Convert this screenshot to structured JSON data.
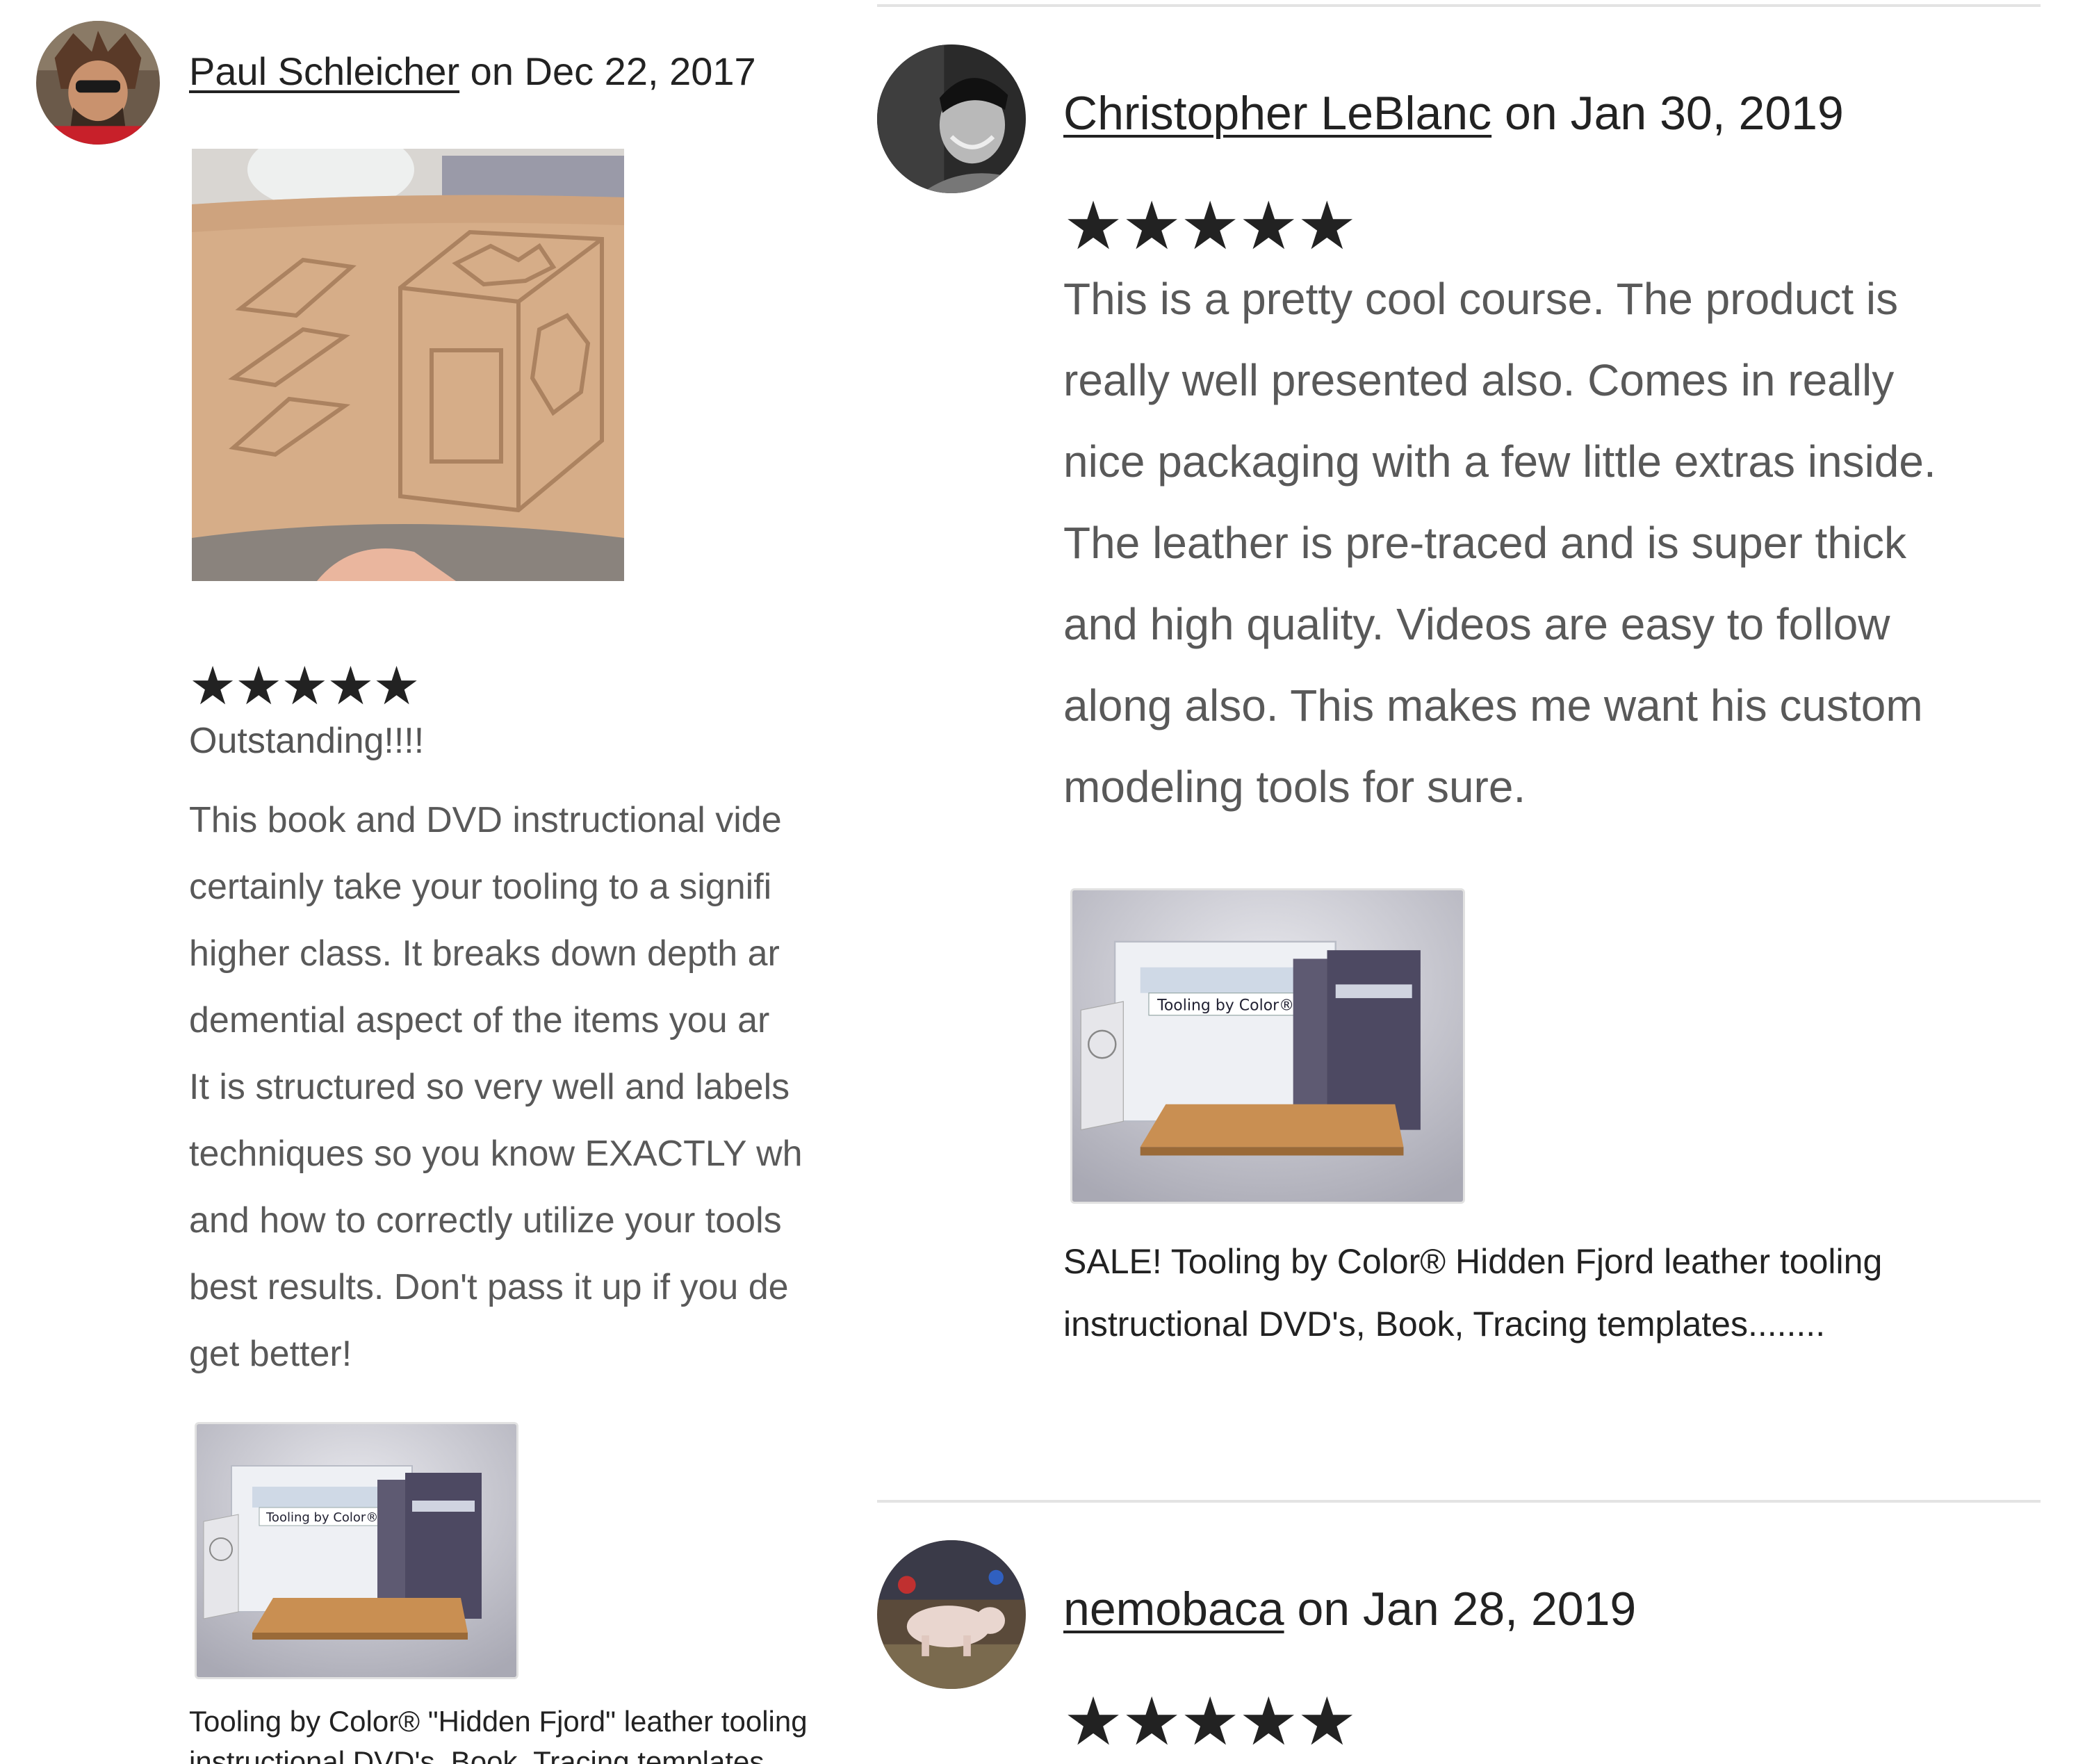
{
  "reviews": [
    {
      "reviewer": "Paul Schleicher",
      "on_word": "on",
      "date": "Dec 22, 2017",
      "stars": "★★★★★",
      "title": "Outstanding!!!!",
      "body_lines": [
        "This book and DVD instructional vide",
        "certainly take your tooling to a signifi",
        "higher class. It breaks down depth ar",
        "demential aspect of the items you ar",
        "It is structured so very well and labels",
        "techniques so you know EXACTLY wh",
        "and how to correctly utilize your tools",
        "best results. Don't pass it up if you de",
        "get better!"
      ],
      "product_cover_title": "Tooling by Color",
      "product_caption_lines": [
        "Tooling by Color® \"Hidden Fjord\" leather tooling",
        "instructional DVD's, Book, Tracing templates"
      ]
    },
    {
      "reviewer": "Christopher LeBlanc",
      "on_word": "on",
      "date": "Jan 30, 2019",
      "stars": "★★★★★",
      "body_lines": [
        "This is a pretty cool course. The product is",
        "really well presented also. Comes in really",
        "nice packaging with a few little extras inside.",
        "The leather is pre-traced and is super thick",
        "and high quality. Videos are easy to follow",
        "along also. This makes me want his custom",
        "modeling tools for sure."
      ],
      "product_cover_title": "Tooling by Color",
      "product_caption_lines": [
        "SALE! Tooling by Color® Hidden Fjord leather tooling",
        "instructional DVD's, Book, Tracing templates........"
      ]
    },
    {
      "reviewer": "nemobaca",
      "on_word": "on",
      "date": "Jan 28, 2019",
      "stars": "★★★★★"
    }
  ],
  "colors": {
    "text_dark": "#222222",
    "text_body": "#595959",
    "divider": "#e3e3e3",
    "leather": "#d4a06b"
  },
  "icons": {
    "star": "★"
  }
}
